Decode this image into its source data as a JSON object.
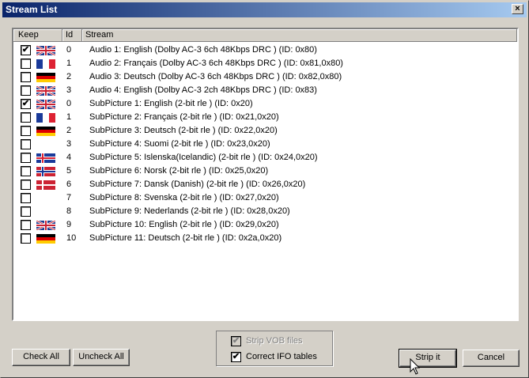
{
  "window": {
    "title": "Stream List",
    "close_glyph": "×"
  },
  "list": {
    "columns": {
      "keep": "Keep",
      "id": "Id",
      "stream": "Stream"
    },
    "rows": [
      {
        "checked": true,
        "flag": "uk-flag",
        "id": "0",
        "stream": "Audio 1: English (Dolby AC-3 6ch 48Kbps DRC ) (ID: 0x80)"
      },
      {
        "checked": false,
        "flag": "france-flag",
        "id": "1",
        "stream": "Audio 2: Français (Dolby AC-3 6ch 48Kbps DRC ) (ID: 0x81,0x80)"
      },
      {
        "checked": false,
        "flag": "germany-flag",
        "id": "2",
        "stream": "Audio 3: Deutsch (Dolby AC-3 6ch 48Kbps DRC ) (ID: 0x82,0x80)"
      },
      {
        "checked": false,
        "flag": "uk-flag",
        "id": "3",
        "stream": "Audio 4: English (Dolby AC-3 2ch 48Kbps DRC ) (ID: 0x83)"
      },
      {
        "checked": true,
        "flag": "uk-flag",
        "id": "0",
        "stream": "SubPicture 1: English (2-bit rle ) (ID: 0x20)"
      },
      {
        "checked": false,
        "flag": "france-flag",
        "id": "1",
        "stream": "SubPicture 2: Français (2-bit rle ) (ID: 0x21,0x20)"
      },
      {
        "checked": false,
        "flag": "germany-flag",
        "id": "2",
        "stream": "SubPicture 3: Deutsch (2-bit rle ) (ID: 0x22,0x20)"
      },
      {
        "checked": false,
        "flag": "",
        "id": "3",
        "stream": "SubPicture 4: Suomi (2-bit rle ) (ID: 0x23,0x20)"
      },
      {
        "checked": false,
        "flag": "iceland-flag",
        "id": "4",
        "stream": "SubPicture 5: Islenska(Icelandic) (2-bit rle ) (ID: 0x24,0x20)"
      },
      {
        "checked": false,
        "flag": "norway-flag",
        "id": "5",
        "stream": "SubPicture 6: Norsk (2-bit rle ) (ID: 0x25,0x20)"
      },
      {
        "checked": false,
        "flag": "denmark-flag",
        "id": "6",
        "stream": "SubPicture 7: Dansk (Danish) (2-bit rle ) (ID: 0x26,0x20)"
      },
      {
        "checked": false,
        "flag": "",
        "id": "7",
        "stream": "SubPicture 8: Svenska (2-bit rle ) (ID: 0x27,0x20)"
      },
      {
        "checked": false,
        "flag": "",
        "id": "8",
        "stream": "SubPicture 9: Nederlands (2-bit rle ) (ID: 0x28,0x20)"
      },
      {
        "checked": false,
        "flag": "uk-flag",
        "id": "9",
        "stream": "SubPicture 10: English (2-bit rle ) (ID: 0x29,0x20)"
      },
      {
        "checked": false,
        "flag": "germany-flag",
        "id": "10",
        "stream": "SubPicture 11: Deutsch (2-bit rle ) (ID: 0x2a,0x20)"
      }
    ]
  },
  "buttons": {
    "check_all": "Check All",
    "uncheck_all": "Uncheck All",
    "strip_it": "Strip it",
    "cancel": "Cancel"
  },
  "options": {
    "strip_vob": {
      "label": "Strip VOB files",
      "checked": true,
      "enabled": false
    },
    "correct_ifo": {
      "label": "Correct IFO tables",
      "checked": true,
      "enabled": true
    }
  },
  "check_glyph": "✔"
}
